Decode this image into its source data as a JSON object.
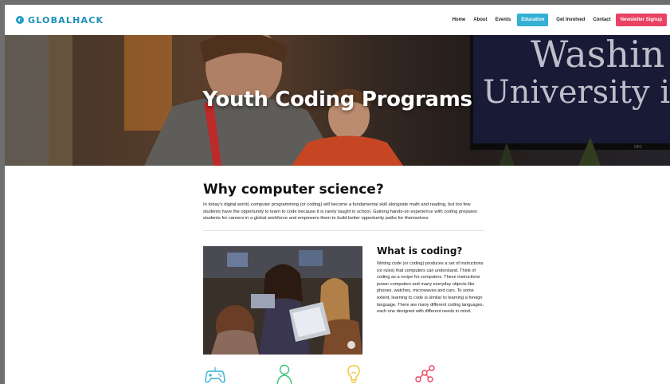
{
  "nav": {
    "logo_text": "GLOBALHACK",
    "links": [
      "Home",
      "About",
      "Events"
    ],
    "active_link": "Education",
    "more_links": [
      "Get Involved",
      "Contact"
    ],
    "signup_label": "Newsletter Signup",
    "colors": {
      "brand": "#1c8fb5",
      "active": "#33b0d4",
      "signup": "#e94262"
    }
  },
  "hero": {
    "title": "Youth Coding Programs",
    "screen_text_1": "Washin",
    "screen_text_2": "University in",
    "tv_brand": "NEC"
  },
  "why": {
    "title": "Why computer science?",
    "body": "In today's digital world, computer programming (or coding) will become a fundamental skill alongside math and reading, but too few students have the opportunity to learn to code because it is rarely taught in school. Gaining hands-on experience with coding prepares students for careers in a global workforce and empowers them to build better opportunity paths for themselves."
  },
  "coding": {
    "title": "What is coding?",
    "body": "Writing code (or coding) produces a set of instructions (or rules) that computers can understand. Think of coding as a recipe for computers. These instructions power computers and many everyday objects like phones, watches, microwaves and cars. To some extent, learning to code is similar to learning a foreign language. There are many different coding languages, each one designed with different needs in mind."
  },
  "icons": [
    {
      "name": "gamepad-icon",
      "color": "#33b0d4"
    },
    {
      "name": "person-icon",
      "color": "#3cc47c"
    },
    {
      "name": "lightbulb-icon",
      "color": "#f2c230"
    },
    {
      "name": "network-icon",
      "color": "#e94262"
    }
  ]
}
